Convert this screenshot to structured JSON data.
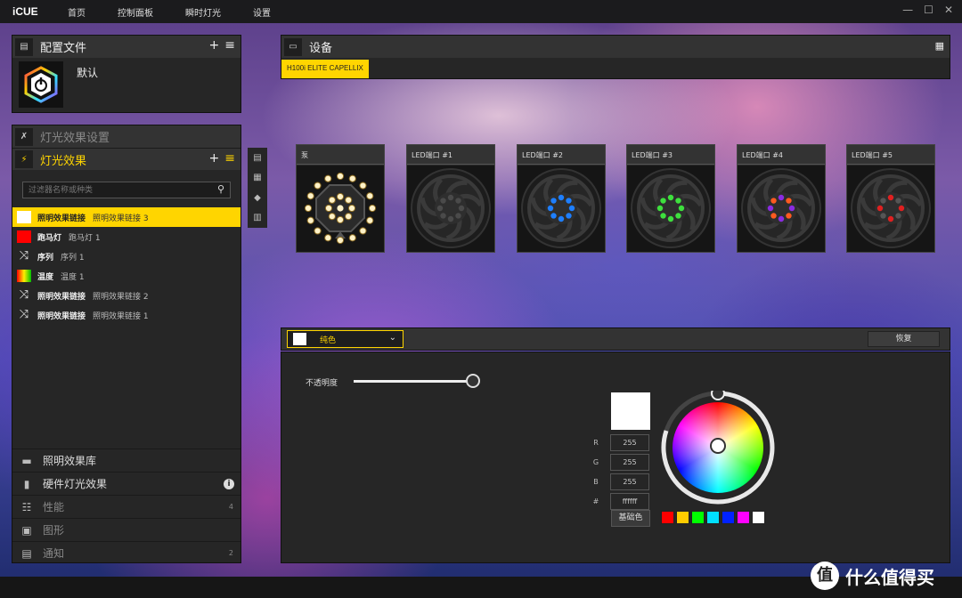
{
  "app": {
    "logo": "iCUE",
    "nav": [
      "首页",
      "控制面板",
      "瞬时灯光",
      "设置"
    ],
    "window_controls": [
      "—",
      "☐",
      "✕"
    ]
  },
  "profiles": {
    "title": "配置文件",
    "add": "+",
    "menu": "≡",
    "current": "默认"
  },
  "effect_settings": {
    "title": "灯光效果设置"
  },
  "effects": {
    "title": "灯光效果",
    "add": "+",
    "menu": "≡",
    "filter_placeholder": "过滤器名称或种类",
    "items": [
      {
        "kind": "swatch",
        "color": "#ffffff",
        "name": "照明效果链接",
        "sub": "照明效果链接 3",
        "selected": true
      },
      {
        "kind": "swatch",
        "color": "#ff0000",
        "name": "跑马灯",
        "sub": "跑马灯 1"
      },
      {
        "kind": "icon",
        "icon": "shuffle-icon",
        "name": "序列",
        "sub": "序列 1"
      },
      {
        "kind": "gradient",
        "name": "温度",
        "sub": "温度 1"
      },
      {
        "kind": "icon",
        "icon": "shuffle-icon",
        "name": "照明效果链接",
        "sub": "照明效果链接 2"
      },
      {
        "kind": "icon",
        "icon": "shuffle-icon",
        "name": "照明效果链接",
        "sub": "照明效果链接 1"
      }
    ]
  },
  "bottom": {
    "library": "照明效果库",
    "hardware": "硬件灯光效果",
    "performance": "性能",
    "performance_count": "4",
    "graphics": "图形",
    "notifications": "通知",
    "notifications_count": "2"
  },
  "devices": {
    "title": "设备",
    "tab": "H100i ELITE CAPELLIX",
    "zones": [
      {
        "label": "泵",
        "color": "#fff2c8"
      },
      {
        "label": "LED端口 #1",
        "color": "#4a4a4a"
      },
      {
        "label": "LED端口 #2",
        "color": "#1e7fff"
      },
      {
        "label": "LED端口 #3",
        "color": "#3ee03e"
      },
      {
        "label": "LED端口 #4",
        "color": "#8a2be2",
        "color2": "#ff5a20"
      },
      {
        "label": "LED端口 #5",
        "color": "#e02020",
        "color2": "#555555"
      }
    ]
  },
  "editor": {
    "mode_label": "纯色",
    "mode_swatch": "#ffffff",
    "restore": "恢复",
    "opacity_label": "不透明度",
    "opacity_value": 1.0,
    "color": {
      "preview": "#ffffff",
      "r_label": "R",
      "g_label": "G",
      "b_label": "B",
      "hex_label": "#",
      "r": "255",
      "g": "255",
      "b": "255",
      "hex": "ffffff",
      "basic_button": "基础色",
      "presets": [
        "#ff0000",
        "#ffcc00",
        "#00ff00",
        "#00e0ff",
        "#0022ff",
        "#ff00ff",
        "#ffffff"
      ]
    }
  },
  "watermark": {
    "text": "什么值得买"
  }
}
